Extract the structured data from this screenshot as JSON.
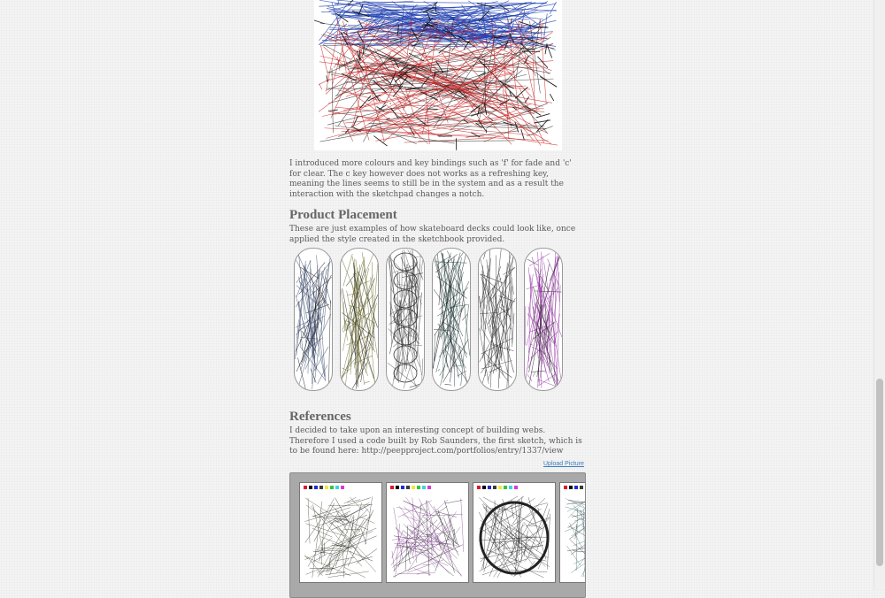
{
  "intro_text": "I introduced more colours and key bindings such as 'f' for fade and 'c' for clear. The c key however does not works as a refreshing key, meaning the lines seems to still be in the system and as a result the interaction with the sketchpad changes a notch.",
  "product_placement": {
    "heading": "Product Placement",
    "text": "These are just examples of how skateboard decks could look like, once applied the style created in the sketchbook provided."
  },
  "references": {
    "heading": "References",
    "text": "I decided to take upon an interesting concept of building webs. Therefore I used a code built by Rob Saunders, the first sketch, which is to be found here: http://peepproject.com/portfolios/entry/1337/view",
    "upload_link": "Upload Picture"
  },
  "palette_colors": [
    "#e0142d",
    "#000000",
    "#1f2bd6",
    "#3a3a3a",
    "#f0e83a",
    "#3ac43a",
    "#3ad6e6",
    "#d63ad6"
  ],
  "deck_colors": [
    "#3b4a6b",
    "#6b6a2a",
    "#555555",
    "#1f3a3a",
    "#333333",
    "#8a2a9a"
  ],
  "thumb_colors": [
    "#3b3b2a",
    "#7a3a8a",
    "#2a2a2a",
    "#3a6a6a"
  ]
}
